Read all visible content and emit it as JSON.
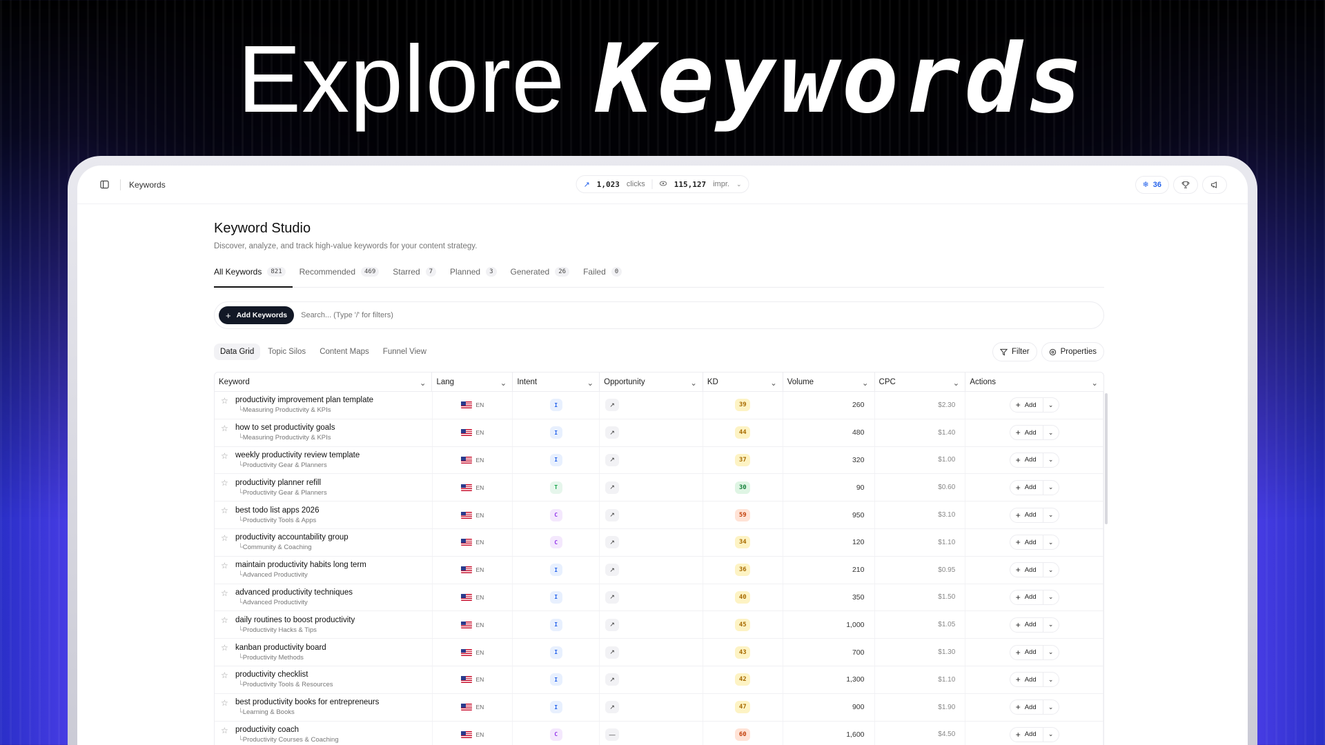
{
  "hero": {
    "word1": "Explore",
    "word2": "Keywords"
  },
  "topbar": {
    "breadcrumb": "Keywords",
    "clicks_value": "1,023",
    "clicks_label": "clicks",
    "impr_value": "115,127",
    "impr_label": "impr.",
    "credits": "36",
    "icons": [
      "sidebar-toggle-icon",
      "trending-up-icon",
      "eye-icon",
      "chevron-down-icon",
      "snowflake-icon",
      "trophy-icon",
      "megaphone-icon"
    ]
  },
  "page": {
    "title": "Keyword Studio",
    "subtitle": "Discover, analyze, and track high-value keywords for your content strategy."
  },
  "tabs": [
    {
      "label": "All Keywords",
      "count": "821",
      "active": true
    },
    {
      "label": "Recommended",
      "count": "469"
    },
    {
      "label": "Starred",
      "count": "7"
    },
    {
      "label": "Planned",
      "count": "3"
    },
    {
      "label": "Generated",
      "count": "26"
    },
    {
      "label": "Failed",
      "count": "0"
    }
  ],
  "search": {
    "add_label": "Add Keywords",
    "placeholder": "Search... (Type '/' for filters)"
  },
  "views": {
    "tabs": [
      "Data Grid",
      "Topic Silos",
      "Content Maps",
      "Funnel View"
    ],
    "active": "Data Grid",
    "filter_label": "Filter",
    "properties_label": "Properties"
  },
  "columns": [
    "Keyword",
    "Lang",
    "Intent",
    "Opportunity",
    "KD",
    "Volume",
    "CPC",
    "Actions"
  ],
  "rows": [
    {
      "keyword": "productivity improvement plan template",
      "silo": "Measuring Productivity & KPIs",
      "lang": "EN",
      "intent": "I",
      "opp": "↗",
      "kd": "39",
      "kd_color": "y",
      "volume": "260",
      "cpc": "$2.30"
    },
    {
      "keyword": "how to set productivity goals",
      "silo": "Measuring Productivity & KPIs",
      "lang": "EN",
      "intent": "I",
      "opp": "↗",
      "kd": "44",
      "kd_color": "y",
      "volume": "480",
      "cpc": "$1.40"
    },
    {
      "keyword": "weekly productivity review template",
      "silo": "Productivity Gear & Planners",
      "lang": "EN",
      "intent": "I",
      "opp": "↗",
      "kd": "37",
      "kd_color": "y",
      "volume": "320",
      "cpc": "$1.00"
    },
    {
      "keyword": "productivity planner refill",
      "silo": "Productivity Gear & Planners",
      "lang": "EN",
      "intent": "T",
      "opp": "↗",
      "kd": "30",
      "kd_color": "g",
      "volume": "90",
      "cpc": "$0.60"
    },
    {
      "keyword": "best todo list apps 2026",
      "silo": "Productivity Tools & Apps",
      "lang": "EN",
      "intent": "C",
      "opp": "↗",
      "kd": "59",
      "kd_color": "o",
      "volume": "950",
      "cpc": "$3.10"
    },
    {
      "keyword": "productivity accountability group",
      "silo": "Community & Coaching",
      "lang": "EN",
      "intent": "C",
      "opp": "↗",
      "kd": "34",
      "kd_color": "y",
      "volume": "120",
      "cpc": "$1.10"
    },
    {
      "keyword": "maintain productivity habits long term",
      "silo": "Advanced Productivity",
      "lang": "EN",
      "intent": "I",
      "opp": "↗",
      "kd": "36",
      "kd_color": "y",
      "volume": "210",
      "cpc": "$0.95"
    },
    {
      "keyword": "advanced productivity techniques",
      "silo": "Advanced Productivity",
      "lang": "EN",
      "intent": "I",
      "opp": "↗",
      "kd": "40",
      "kd_color": "y",
      "volume": "350",
      "cpc": "$1.50"
    },
    {
      "keyword": "daily routines to boost productivity",
      "silo": "Productivity Hacks & Tips",
      "lang": "EN",
      "intent": "I",
      "opp": "↗",
      "kd": "45",
      "kd_color": "y",
      "volume": "1,000",
      "cpc": "$1.05"
    },
    {
      "keyword": "kanban productivity board",
      "silo": "Productivity Methods",
      "lang": "EN",
      "intent": "I",
      "opp": "↗",
      "kd": "43",
      "kd_color": "y",
      "volume": "700",
      "cpc": "$1.30"
    },
    {
      "keyword": "productivity checklist",
      "silo": "Productivity Tools & Resources",
      "lang": "EN",
      "intent": "I",
      "opp": "↗",
      "kd": "42",
      "kd_color": "y",
      "volume": "1,300",
      "cpc": "$1.10"
    },
    {
      "keyword": "best productivity books for entrepreneurs",
      "silo": "Learning & Books",
      "lang": "EN",
      "intent": "I",
      "opp": "↗",
      "kd": "47",
      "kd_color": "y",
      "volume": "900",
      "cpc": "$1.90"
    },
    {
      "keyword": "productivity coach",
      "silo": "Productivity Courses & Coaching",
      "lang": "EN",
      "intent": "C",
      "opp": "—",
      "kd": "60",
      "kd_color": "o",
      "volume": "1,600",
      "cpc": "$4.50"
    }
  ],
  "row_action_label": "Add",
  "colors": {
    "accent": "#121826",
    "link_blue": "#2563eb",
    "intent_info": "#2563eb",
    "intent_trans": "#16a34a",
    "intent_comm": "#9333ea"
  }
}
